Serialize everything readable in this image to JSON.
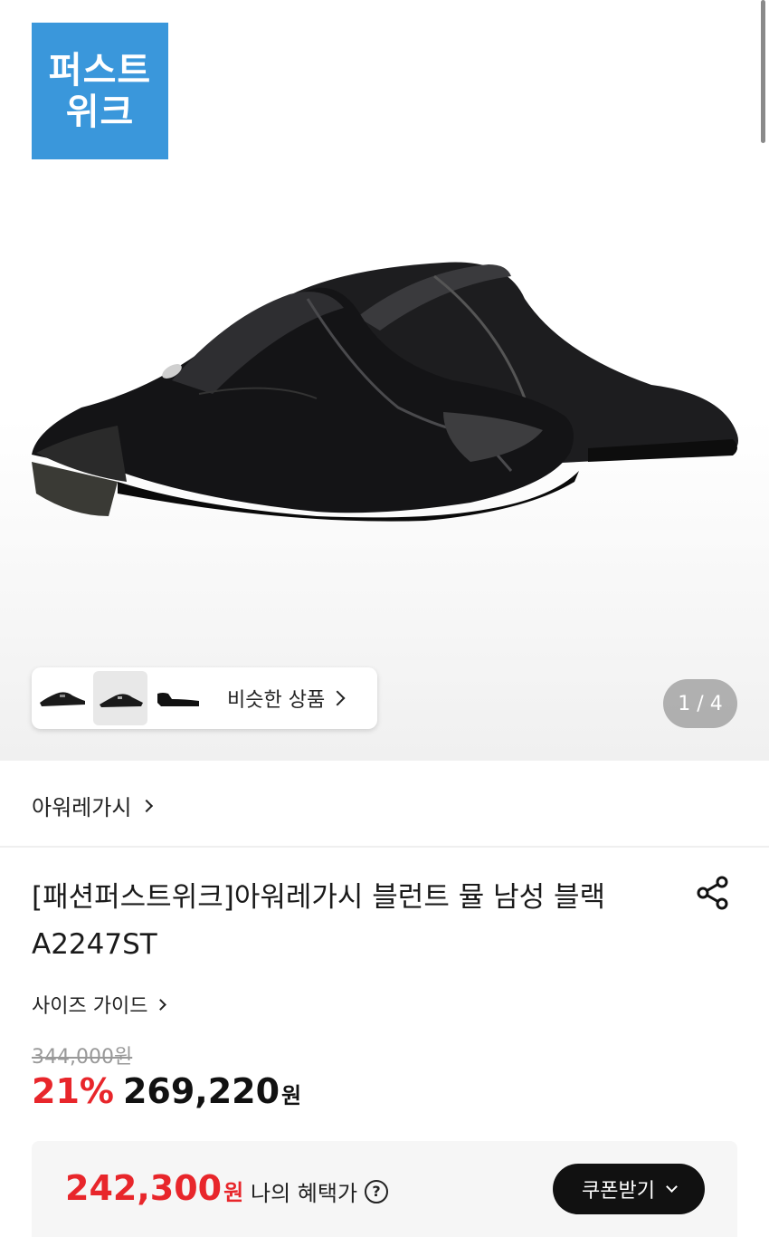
{
  "badge": {
    "line1": "퍼스트",
    "line2": "위크"
  },
  "gallery": {
    "similar_label": "비슷한 상품",
    "pager": "1 / 4"
  },
  "brand": {
    "name": "아워레가시"
  },
  "product": {
    "title": "[패션퍼스트위크]아워레가시 블런트 뮬 남성 블랙 A2247ST",
    "size_guide": "사이즈 가이드"
  },
  "price": {
    "original": "344,000원",
    "discount": "21%",
    "sale": "269,220",
    "won": "원"
  },
  "benefit": {
    "price": "242,300",
    "won": "원",
    "label": "나의 혜택가",
    "help": "?",
    "coupon_button": "쿠폰받기"
  },
  "colors": {
    "badge": "#3a97db",
    "accent": "#e8262b"
  }
}
